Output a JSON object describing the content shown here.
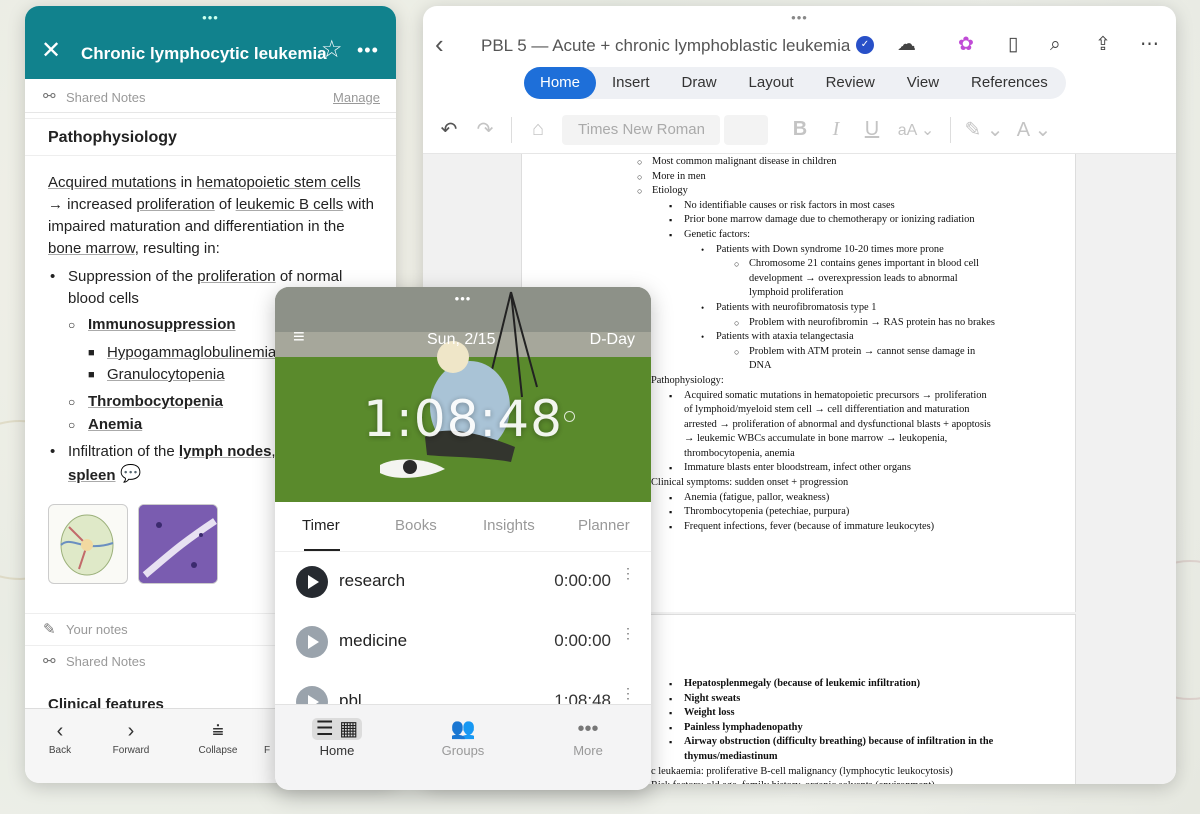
{
  "word": {
    "title": "PBL 5 — Acute + chronic lymphoblastic leukemia",
    "tabs": [
      "Home",
      "Insert",
      "Draw",
      "Layout",
      "Review",
      "View",
      "References"
    ],
    "active_tab": "Home",
    "font_name": "Times New Roman",
    "page1_lines": [
      {
        "lvl": 2,
        "t": "Most common malignant disease in children"
      },
      {
        "lvl": 2,
        "t": "More in men"
      },
      {
        "lvl": 2,
        "t": "Etiology"
      },
      {
        "lvl": 3,
        "t": "No identifiable causes or risk factors in most cases"
      },
      {
        "lvl": 3,
        "t": "Prior bone marrow damage due to chemotherapy or ionizing radiation"
      },
      {
        "lvl": 3,
        "t": "Genetic factors:"
      },
      {
        "lvl": 4,
        "t": "Patients with Down syndrome 10-20 times more prone"
      },
      {
        "lvl": 5,
        "t": "Chromosome 21 contains genes important in blood cell"
      },
      {
        "lvl": 6,
        "t": "development → overexpression leads to abnormal"
      },
      {
        "lvl": 6,
        "t": "lymphoid proliferation"
      },
      {
        "lvl": 4,
        "t": "Patients with neurofibromatosis type 1"
      },
      {
        "lvl": 5,
        "t": "Problem with neurofibromin → RAS protein has no brakes"
      },
      {
        "lvl": 4,
        "t": "Patients with ataxia telangectasia"
      },
      {
        "lvl": 5,
        "t": "Problem with ATM protein → cannot sense damage in"
      },
      {
        "lvl": 6,
        "t": "DNA"
      },
      {
        "lvl": 0,
        "t": "Pathophysiology:"
      },
      {
        "lvl": 3,
        "t": "Acquired somatic mutations in hematopoietic precursors → proliferation"
      },
      {
        "lvl": 7,
        "t": "of lymphoid/myeloid stem cell → cell differentiation and maturation"
      },
      {
        "lvl": 7,
        "t": "arrested → proliferation of abnormal and dysfunctional blasts + apoptosis"
      },
      {
        "lvl": 7,
        "t": "→ leukemic WBCs accumulate in bone marrow → leukopenia,"
      },
      {
        "lvl": 7,
        "t": "thrombocytopenia, anemia"
      },
      {
        "lvl": 3,
        "t": "Immature blasts enter bloodstream, infect other organs"
      },
      {
        "lvl": 0,
        "t": "Clinical symptoms: sudden onset + progression"
      },
      {
        "lvl": 3,
        "t": "Anemia (fatigue, pallor, weakness)"
      },
      {
        "lvl": 3,
        "t": "Thrombocytopenia (petechiae, purpura)"
      },
      {
        "lvl": 3,
        "t": "Frequent infections, fever (because of immature leukocytes)"
      }
    ],
    "page2_lines": [
      {
        "lvl": 3,
        "bold": true,
        "t": "Hepatosplenmegaly (because of leukemic infiltration)"
      },
      {
        "lvl": 3,
        "bold": true,
        "t": "Night sweats"
      },
      {
        "lvl": 3,
        "bold": true,
        "t": "Weight loss"
      },
      {
        "lvl": 3,
        "bold": true,
        "t": "Painless lymphadenopathy"
      },
      {
        "lvl": 3,
        "bold": true,
        "t": "Airway obstruction (difficulty breathing) because of infiltration in the"
      },
      {
        "lvl": 7,
        "bold": true,
        "t": "thymus/mediastinum"
      },
      {
        "lvl": 8,
        "t": "c leukaemia: proliferative B-cell malignancy (lymphocytic leukocytosis)"
      },
      {
        "lvl": 8,
        "t": "Risk factors: old age, family history, organic solvents (environment)"
      }
    ]
  },
  "notes": {
    "title": "Chronic lymphocytic leukemia",
    "shared_notes": "Shared Notes",
    "manage": "Manage",
    "section": "Pathophysiology",
    "para": {
      "p1": "Acquired mutations",
      "p2": " in ",
      "p3": "hematopoietic stem cells",
      "p4": " → increased ",
      "p5": "proliferation",
      "p6": " of ",
      "p7": "leukemic B cells",
      "p8": " with impaired maturation and differentiation in the ",
      "p9": "bone marrow",
      "p10": ", resulting in:"
    },
    "list": {
      "suppression_a": "Suppression of the ",
      "suppression_b": "proliferation",
      "suppression_c": " of normal",
      "suppression_d": "blood cells",
      "immuno": "Immunosuppression",
      "hypo": "Hypogammaglobulinemia",
      "granulo": "Granulocytopenia",
      "thrombo": "Thrombocytopenia",
      "anemia": "Anemia",
      "infil_a": "Infiltration of the ",
      "infil_b": "lymph nodes",
      "infil_c": ",",
      "spleen": "spleen"
    },
    "your_notes": "Your notes",
    "shared_notes_2": "Shared Notes",
    "clinical": "Clinical features",
    "bottom": {
      "back": "Back",
      "forward": "Forward",
      "collapse": "Collapse",
      "fourth": "F"
    }
  },
  "timer": {
    "date": "Sun, 2/15",
    "dday": "D-Day",
    "clock": "1:08:48",
    "tabs": [
      "Timer",
      "Books",
      "Insights",
      "Planner"
    ],
    "active_tab": "Timer",
    "rows": [
      {
        "name": "research",
        "time": "0:00:00",
        "active": true
      },
      {
        "name": "medicine",
        "time": "0:00:00",
        "active": false
      },
      {
        "name": "pbl",
        "time": "1:08:48",
        "active": false
      }
    ],
    "nav": {
      "home": "Home",
      "groups": "Groups",
      "more": "More"
    }
  },
  "colors": {
    "notes_header": "#11828d",
    "word_accent": "#1e6fd9"
  }
}
